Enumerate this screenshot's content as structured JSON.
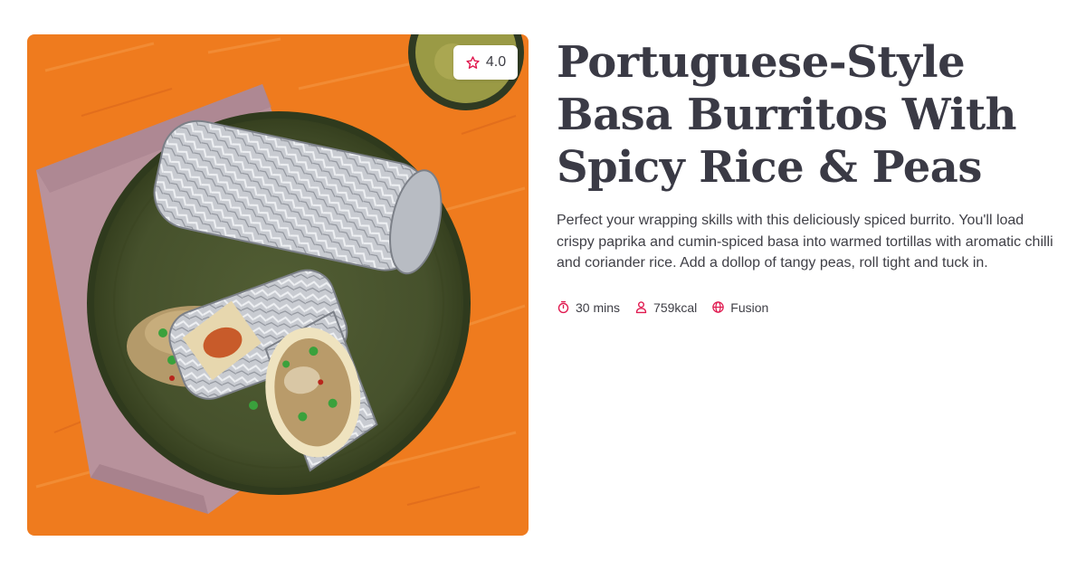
{
  "recipe": {
    "title": "Portuguese-Style Basa Burritos With Spicy Rice & Peas",
    "description": "Perfect your wrapping skills with this deliciously spiced burrito. You'll load crispy paprika and cumin-spiced basa into warmed tortillas with aromatic chilli and coriander rice. Add a dollop of tangy peas, roll tight and tuck in.",
    "rating": "4.0",
    "meta": {
      "time": "30 mins",
      "calories": "759kcal",
      "cuisine": "Fusion"
    }
  },
  "colors": {
    "accent": "#e0194f",
    "title": "#3a3a45",
    "text": "#3f3f46",
    "background_orange": "#ef7b1e",
    "plate_green": "#4a5530",
    "napkin_mauve": "#b8929c",
    "foil_silver": "#c9ccd2"
  },
  "icons": {
    "rating": "star-icon",
    "time": "stopwatch-icon",
    "calories": "person-icon",
    "cuisine": "globe-icon"
  }
}
